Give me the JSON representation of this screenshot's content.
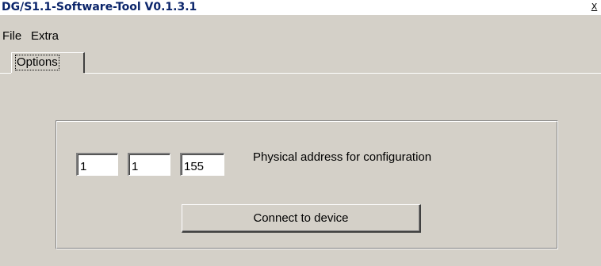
{
  "window": {
    "title": "DG/S1.1-Software-Tool V0.1.3.1",
    "close_label": "X"
  },
  "menu": {
    "items": [
      {
        "label": "File"
      },
      {
        "label": "Extra"
      }
    ]
  },
  "tabs": [
    {
      "label": "Options",
      "selected": true
    }
  ],
  "address": {
    "fields": [
      {
        "value": "1"
      },
      {
        "value": "1"
      },
      {
        "value": "155"
      }
    ],
    "label": "Physical address for configuration"
  },
  "connect_button": {
    "label": "Connect to device"
  },
  "colors": {
    "background": "#d4d0c8",
    "title_text": "#0a246a"
  }
}
